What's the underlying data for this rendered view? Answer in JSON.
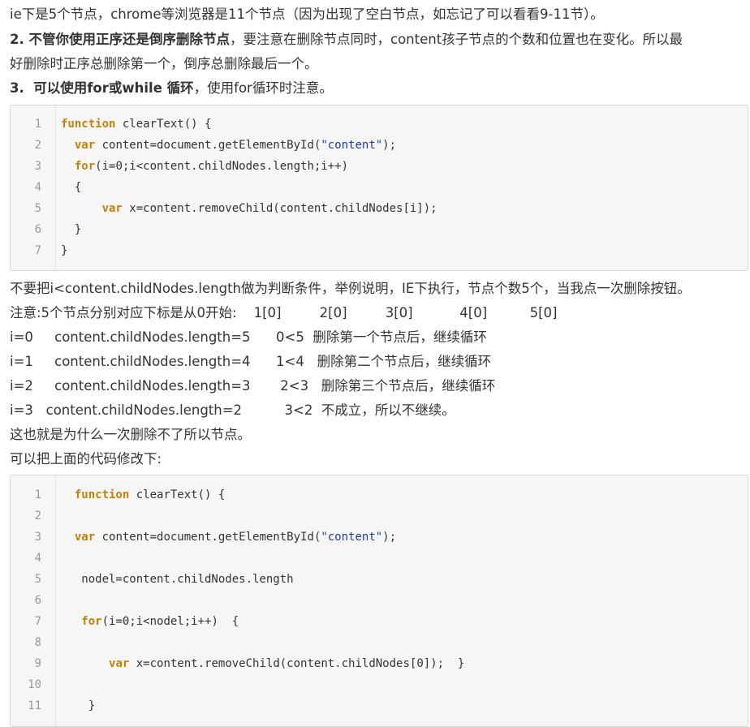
{
  "intro_text": "ie下是5个节点，chrome等浏览器是11个节点（因为出现了空白节点，如忘记了可以看看9-11节）。",
  "point2": {
    "bold": "2. 不管你使用正序还是倒序删除节点",
    "rest": "，要注意在删除节点同时，content孩子节点的个数和位置也在变化。所以最",
    "line2": "好删除时正序总删除第一个，倒序总删除最后一个。"
  },
  "point3": {
    "bold": "3.  可以使用for或while 循环",
    "rest": "，使用for循环时注意。"
  },
  "code_block_1": {
    "lines": [
      {
        "num": "1",
        "parts": [
          {
            "t": "function",
            "k": "kw"
          },
          {
            "t": " clearText() {",
            "k": ""
          }
        ]
      },
      {
        "num": "2",
        "parts": [
          {
            "t": "  ",
            "k": ""
          },
          {
            "t": "var",
            "k": "kw"
          },
          {
            "t": " content=document.getElementById(",
            "k": ""
          },
          {
            "t": "\"content\"",
            "k": "str"
          },
          {
            "t": ");",
            "k": ""
          }
        ]
      },
      {
        "num": "3",
        "parts": [
          {
            "t": "  ",
            "k": ""
          },
          {
            "t": "for",
            "k": "kw"
          },
          {
            "t": "(i=0;i<content.childNodes.length;i++)",
            "k": ""
          }
        ]
      },
      {
        "num": "4",
        "parts": [
          {
            "t": "  {",
            "k": ""
          }
        ]
      },
      {
        "num": "5",
        "parts": [
          {
            "t": "      ",
            "k": ""
          },
          {
            "t": "var",
            "k": "kw"
          },
          {
            "t": " x=content.removeChild(content.childNodes[i]);",
            "k": ""
          }
        ]
      },
      {
        "num": "6",
        "parts": [
          {
            "t": "  }",
            "k": ""
          }
        ]
      },
      {
        "num": "7",
        "parts": [
          {
            "t": "}",
            "k": ""
          }
        ]
      }
    ]
  },
  "explain": {
    "line1": "不要把i<content.childNodes.length做为判断条件，举例说明，IE下执行，节点个数5个，当我点一次删除按钮。",
    "line2": "注意:5个节点分别对应下标是从0开始:    1[0]         2[0]         3[0]           4[0]          5[0]",
    "line3": "i=0     content.childNodes.length=5      0<5  删除第一个节点后，继续循环",
    "line4": "i=1     content.childNodes.length=4      1<4   删除第二个节点后，继续循环",
    "line5": "i=2     content.childNodes.length=3       2<3   删除第三个节点后，继续循环",
    "line6": "i=3   content.childNodes.length=2          3<2  不成立，所以不继续。",
    "line7": "这也就是为什么一次删除不了所以节点。",
    "line8": "可以把上面的代码修改下:"
  },
  "code_block_2": {
    "lines": [
      {
        "num": "1",
        "parts": [
          {
            "t": "  ",
            "k": ""
          },
          {
            "t": "function",
            "k": "kw"
          },
          {
            "t": " clearText() {",
            "k": ""
          }
        ]
      },
      {
        "num": "2",
        "parts": []
      },
      {
        "num": "3",
        "parts": [
          {
            "t": "  ",
            "k": ""
          },
          {
            "t": "var",
            "k": "kw"
          },
          {
            "t": " content=document.getElementById(",
            "k": ""
          },
          {
            "t": "\"content\"",
            "k": "str"
          },
          {
            "t": ");",
            "k": ""
          }
        ]
      },
      {
        "num": "4",
        "parts": []
      },
      {
        "num": "5",
        "parts": [
          {
            "t": "   nodel=content.childNodes.length",
            "k": ""
          }
        ]
      },
      {
        "num": "6",
        "parts": []
      },
      {
        "num": "7",
        "parts": [
          {
            "t": "   ",
            "k": ""
          },
          {
            "t": "for",
            "k": "kw"
          },
          {
            "t": "(i=0;i<nodel;i++)  {",
            "k": ""
          }
        ]
      },
      {
        "num": "8",
        "parts": []
      },
      {
        "num": "9",
        "parts": [
          {
            "t": "       ",
            "k": ""
          },
          {
            "t": "var",
            "k": "kw"
          },
          {
            "t": " x=content.removeChild(content.childNodes[0]);  }",
            "k": ""
          }
        ]
      },
      {
        "num": "10",
        "parts": []
      },
      {
        "num": "11",
        "parts": [
          {
            "t": "    }",
            "k": ""
          }
        ]
      }
    ]
  }
}
